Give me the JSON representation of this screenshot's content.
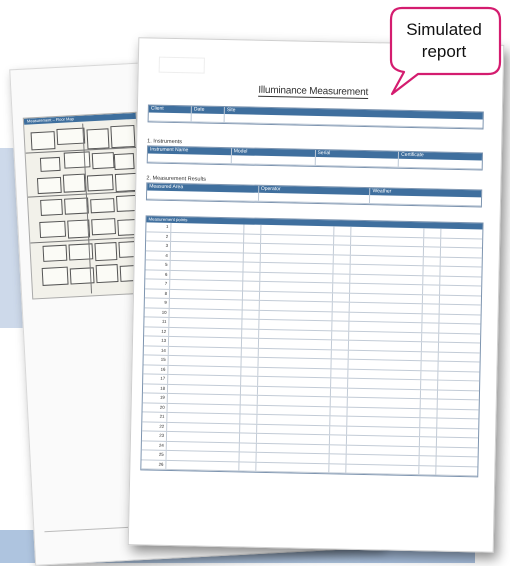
{
  "bubble": {
    "line1": "Simulated",
    "line2": "report"
  },
  "colors": {
    "header_blue": "#3f6f9e",
    "bubble_border": "#d41c6f",
    "background_blue": "#b6c9e2"
  },
  "report": {
    "title": "Illuminance Measurement",
    "info_headers": [
      "Client",
      "Date",
      "Site"
    ],
    "info_values": [
      "",
      "",
      ""
    ],
    "section_1_title": "1. Instruments",
    "instrument_headers": [
      "Instrument Name",
      "Model",
      "Serial",
      "Certificate"
    ],
    "instrument_values": [
      "",
      "",
      "",
      ""
    ],
    "section_2_title": "2. Measurement Results",
    "results_headers": [
      "Measured Area",
      "Operator",
      "Weather"
    ],
    "results_values": [
      "",
      "",
      ""
    ],
    "points_header": "Measurement points",
    "rows": [
      {
        "no": "1"
      },
      {
        "no": "2"
      },
      {
        "no": "3"
      },
      {
        "no": "4"
      },
      {
        "no": "5"
      },
      {
        "no": "6"
      },
      {
        "no": "7"
      },
      {
        "no": "8"
      },
      {
        "no": "9"
      },
      {
        "no": "10"
      },
      {
        "no": "11"
      },
      {
        "no": "12"
      },
      {
        "no": "13"
      },
      {
        "no": "14"
      },
      {
        "no": "15"
      },
      {
        "no": "16"
      },
      {
        "no": "17"
      },
      {
        "no": "18"
      },
      {
        "no": "19"
      },
      {
        "no": "20"
      },
      {
        "no": "21"
      },
      {
        "no": "22"
      },
      {
        "no": "23"
      },
      {
        "no": "24"
      },
      {
        "no": "25"
      },
      {
        "no": "26"
      }
    ]
  },
  "back_page": {
    "floor_title": "Measurement – Floor Map"
  }
}
